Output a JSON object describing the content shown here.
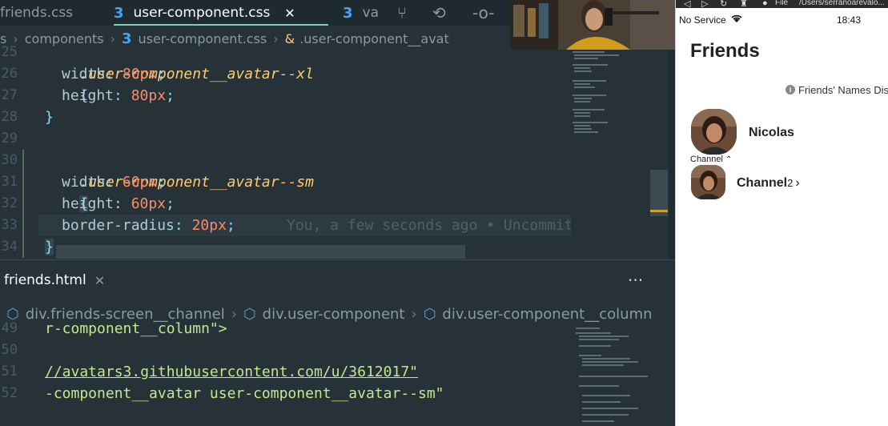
{
  "editor": {
    "tabs": [
      {
        "label": "friends.css"
      },
      {
        "label": "user-component.css",
        "close": "✕",
        "active": true
      },
      {
        "label": "va"
      }
    ],
    "breadcrumb": [
      "s",
      "components",
      "user-component.css",
      ".user-component__avat"
    ],
    "lines": [
      {
        "n": "25",
        "selector": ".user-component__avatar--xl",
        "brace": "{"
      },
      {
        "n": "26",
        "prop": "width",
        "value": "80px"
      },
      {
        "n": "27",
        "prop": "height",
        "value": "80px"
      },
      {
        "n": "28",
        "brace": "}"
      },
      {
        "n": "29"
      },
      {
        "n": "30",
        "selector": ".user-component__avatar--sm",
        "brace": "{"
      },
      {
        "n": "31",
        "prop": "width",
        "value": "60px"
      },
      {
        "n": "32",
        "prop": "height",
        "value": "60px"
      },
      {
        "n": "33",
        "prop": "border-radius",
        "value": "20px"
      },
      {
        "n": "34",
        "brace": "}"
      }
    ],
    "blame": "You, a few seconds ago • Uncommit"
  },
  "panel": {
    "tab": {
      "label": "friends.html",
      "close": "✕",
      "more": "···"
    },
    "breadcrumb": [
      "div.friends-screen__channel",
      "div.user-component",
      "div.user-component__column"
    ],
    "lines": [
      {
        "n": "49",
        "text": "r-component__column\">"
      },
      {
        "n": "50",
        "text": ""
      },
      {
        "n": "51",
        "text": "//avatars3.githubusercontent.com/u/3612017\""
      },
      {
        "n": "52",
        "text": "-component__avatar user-component__avatar--sm\""
      }
    ]
  },
  "simulator": {
    "chrome": {
      "file": "File",
      "path": "/Users/serranoarevalo..."
    },
    "status": {
      "carrier": "No Service",
      "time": "18:43"
    },
    "title": "Friends",
    "banner": "Friends' Names Dis",
    "user": {
      "name": "Nicolas"
    },
    "channel_toggle": "Channel",
    "channel": {
      "name": "Channel",
      "count": "2",
      "chevron": "›"
    }
  },
  "colors": {
    "selector": "#ffcb6b",
    "number": "#f78c6c",
    "string": "#c3e88d",
    "accent": "#80cbc4"
  }
}
